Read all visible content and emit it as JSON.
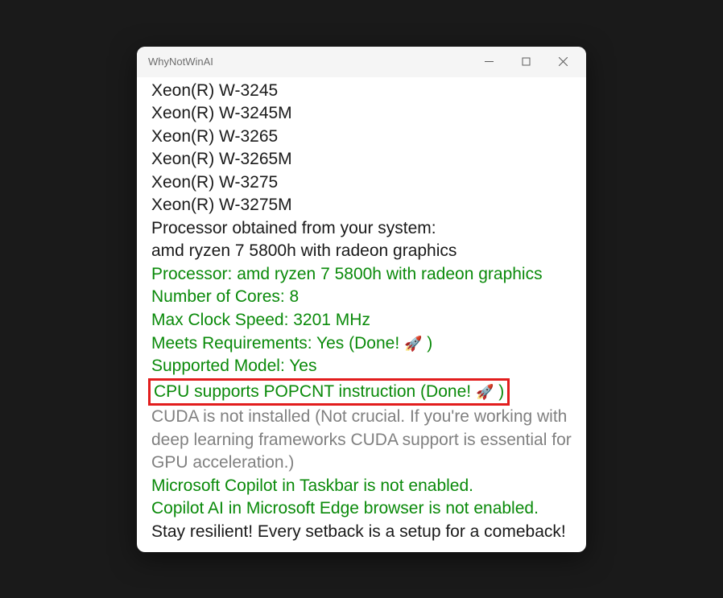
{
  "window": {
    "title": "WhyNotWinAI"
  },
  "lines": {
    "cpu1": "Xeon(R) W-3245",
    "cpu2": "Xeon(R) W-3245M",
    "cpu3": "Xeon(R) W-3265",
    "cpu4": "Xeon(R) W-3265M",
    "cpu5": "Xeon(R) W-3275",
    "cpu6": "Xeon(R) W-3275M",
    "proc_obtained": "Processor obtained from your system:",
    "proc_name": "amd ryzen 7 5800h with radeon graphics",
    "proc_line": "Processor: amd ryzen 7 5800h with radeon graphics",
    "cores": "Number of Cores: 8",
    "clock": "Max Clock Speed: 3201 MHz",
    "meets_req_pre": "Meets Requirements: Yes (Done! ",
    "meets_req_post": " )",
    "supported": "Supported Model: Yes",
    "popcnt_pre": "CPU supports POPCNT instruction (Done! ",
    "popcnt_post": " )",
    "cuda": "CUDA is not installed (Not crucial. If you're working with deep learning frameworks CUDA support is essential for GPU acceleration.)",
    "copilot_taskbar": "Microsoft Copilot in Taskbar is not enabled.",
    "copilot_edge": "Copilot AI in Microsoft Edge browser is not enabled.",
    "resilient": "Stay resilient! Every setback is a setup for a comeback!"
  },
  "icons": {
    "rocket": "🚀"
  },
  "colors": {
    "success": "#0a8a0a",
    "muted": "#808080",
    "highlight_border": "#e21d1d"
  }
}
